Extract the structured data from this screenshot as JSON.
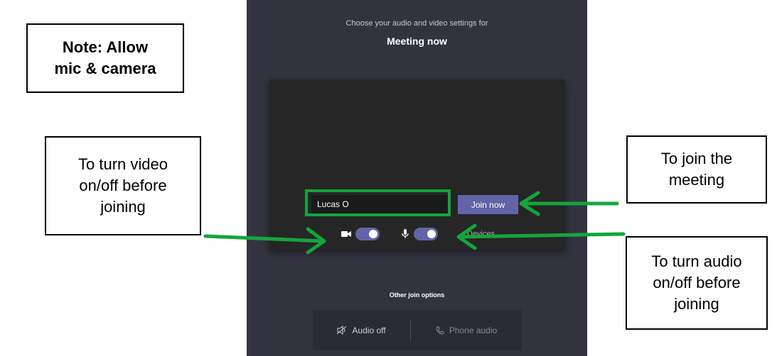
{
  "panel": {
    "subtitle": "Choose your audio and video settings for",
    "title": "Meeting now",
    "name_input_value": "Lucas O",
    "join_button_label": "Join now",
    "devices_label": "Devices",
    "video_toggle_on": true,
    "audio_toggle_on": true,
    "other_join_options_label": "Other join options",
    "join_options": [
      {
        "label": "Audio off",
        "icon": "speaker-off-icon"
      },
      {
        "label": "Phone audio",
        "icon": "phone-icon"
      }
    ],
    "accent_color": "#6264a7",
    "background_color": "#33333f"
  },
  "annotations": {
    "note": [
      "Note: Allow",
      "mic & camera"
    ],
    "video": [
      "To turn video",
      "on/off before",
      "joining"
    ],
    "join": [
      "To join the",
      "meeting"
    ],
    "audio": [
      "To turn audio",
      "on/off before",
      "joining"
    ],
    "highlight_color": "#14a53c"
  }
}
